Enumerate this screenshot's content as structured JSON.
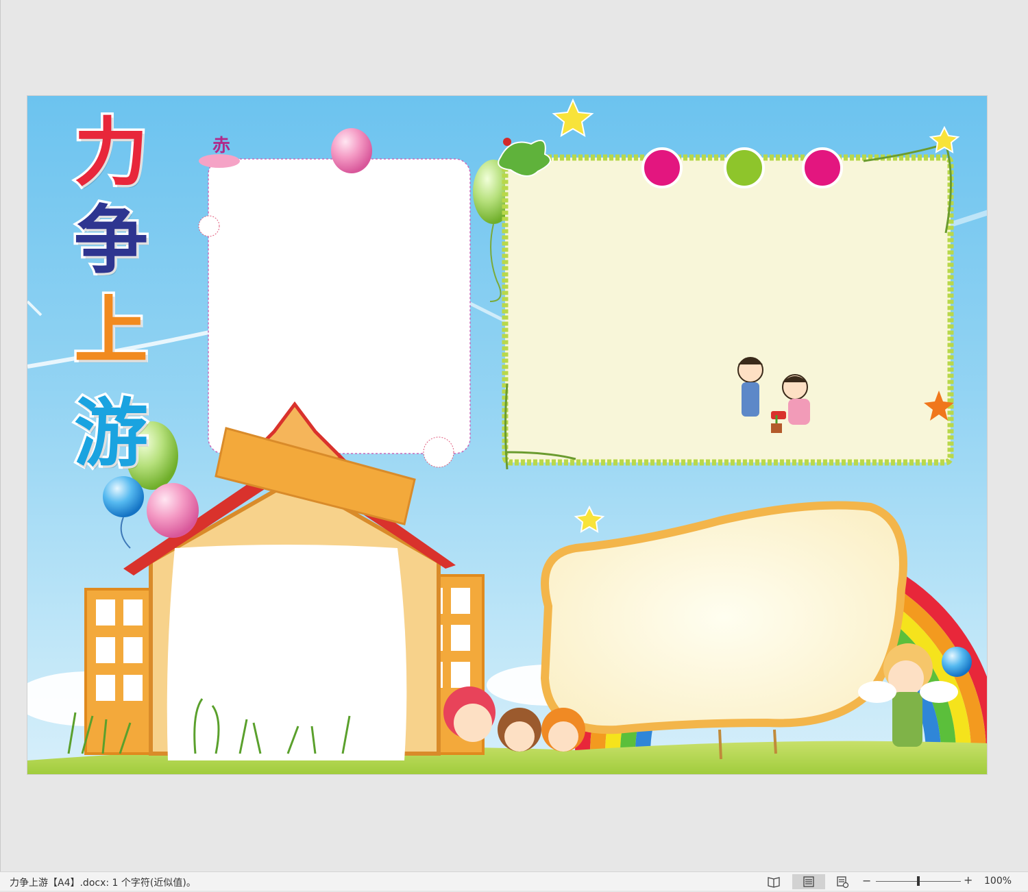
{
  "document": {
    "title_chars": [
      "力",
      "争",
      "上",
      "游"
    ],
    "small_label": "赤"
  },
  "colors": {
    "title_char_colors": [
      "#e8273a",
      "#2e3590",
      "#f18a1f",
      "#1aa3e0"
    ],
    "sky_top": "#6cc3ef",
    "sky_bottom": "#d7effa",
    "frame_border": "#b9d84a",
    "frame_fill": "#f8f6d9"
  },
  "statusbar": {
    "text": "力争上游【A4】.docx: 1 个字符(近似值)。",
    "zoom_label": "100%",
    "zoom_minus": "−",
    "zoom_plus": "+",
    "icons": [
      "read-mode-icon",
      "print-layout-icon",
      "web-layout-icon"
    ]
  }
}
